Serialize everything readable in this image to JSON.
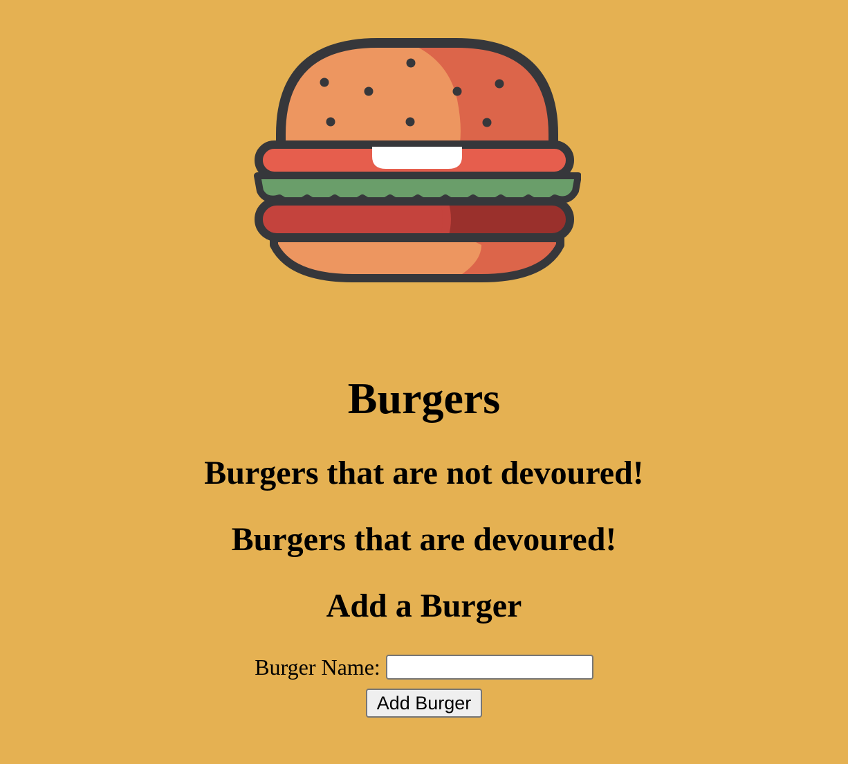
{
  "logo": {
    "icon": "hamburger-icon",
    "colors": {
      "bun_light": "#ed9660",
      "bun_dark": "#dc654a",
      "tomato": "#e65e4d",
      "lettuce": "#6a9e6a",
      "patty": "#c4433d",
      "patty_dark": "#9a302c",
      "outline": "#36373b",
      "cheese": "#ffffff"
    }
  },
  "page": {
    "title": "Burgers",
    "background": "#e5b152"
  },
  "sections": {
    "undevoured_heading": "Burgers that are not devoured!",
    "devoured_heading": "Burgers that are devoured!",
    "add_heading": "Add a Burger"
  },
  "form": {
    "name_label": "Burger Name:",
    "name_value": "",
    "name_placeholder": "",
    "submit_label": "Add Burger"
  }
}
